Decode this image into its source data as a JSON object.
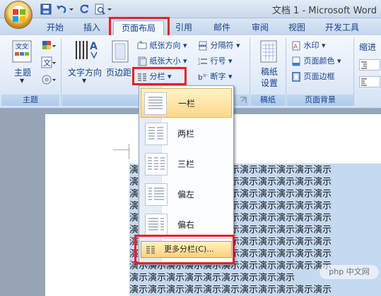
{
  "window": {
    "title": "文档 1 - Microsoft Word"
  },
  "quick_access": {
    "icons": [
      "save-icon",
      "undo-icon",
      "redo-icon",
      "print-preview-icon",
      "customize-icon"
    ]
  },
  "tabs": [
    {
      "label": "开始"
    },
    {
      "label": "插入"
    },
    {
      "label": "页面布局",
      "active": true
    },
    {
      "label": "引用"
    },
    {
      "label": "邮件"
    },
    {
      "label": "审阅"
    },
    {
      "label": "视图"
    },
    {
      "label": "开发工具"
    }
  ],
  "ribbon": {
    "theme_group": {
      "theme_label": "主题",
      "group_label": "主题"
    },
    "page_setup": {
      "text_direction": "文字方向",
      "margins": "页边距",
      "orientation": "纸张方向",
      "size": "纸张大小",
      "columns": "分栏",
      "breaks": "分隔符",
      "line_numbers": "行号",
      "hyphenation": "断字",
      "group_label": "页"
    },
    "manuscript": {
      "label": "稿纸\n设置",
      "label_line1": "稿纸",
      "label_line2": "设置",
      "group_label": "稿纸"
    },
    "page_background": {
      "watermark": "水印",
      "page_color": "页面颜色",
      "page_borders": "页面边框",
      "group_label": "页面背景"
    },
    "indent": {
      "label": "缩进"
    }
  },
  "columns_menu": {
    "items": [
      {
        "label": "一栏",
        "selected": true
      },
      {
        "label": "两栏"
      },
      {
        "label": "三栏"
      },
      {
        "label": "偏左"
      },
      {
        "label": "偏右"
      }
    ],
    "more": "更多分栏(C)..."
  },
  "document": {
    "text_line": "演示演示演示演示演示演示演示演示演示演示演示",
    "short_line": "演示演示演示演示演示演示演示演示演示"
  },
  "watermark_text": "php 中文网",
  "colors": {
    "highlight_box": "#e8202a",
    "accent": "#15428b"
  }
}
